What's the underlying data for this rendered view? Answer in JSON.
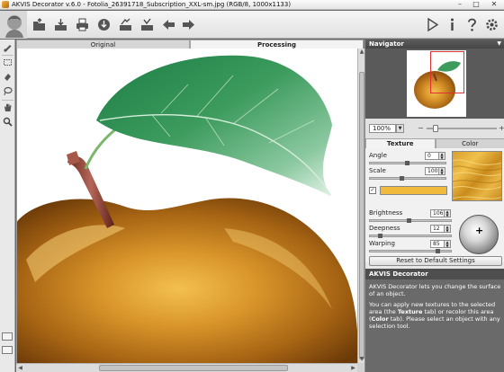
{
  "window": {
    "title": "AKVIS Decorator v.6.0 - Fotolia_26391718_Subscription_XXL-sm.jpg (RGB/8, 1000x1133)",
    "minimize": "–",
    "maximize": "□",
    "close": "✕"
  },
  "toolbar": {
    "left_icons": [
      "open-icon",
      "save-icon",
      "print-icon",
      "share-icon",
      "batch-icon",
      "presets-icon",
      "undo-icon",
      "redo-icon"
    ],
    "right_icons": [
      "run-icon",
      "info-icon",
      "help-icon",
      "settings-icon"
    ]
  },
  "image_tabs": {
    "original": "Original",
    "processing": "Processing"
  },
  "navigator": {
    "title": "Navigator",
    "zoom_value": "100%",
    "zoom_minus": "−",
    "zoom_plus": "+",
    "zoom_fraction": 0.1
  },
  "settings_tabs": {
    "texture": "Texture",
    "color": "Color"
  },
  "params": {
    "angle": {
      "label": "Angle",
      "value": "0"
    },
    "scale": {
      "label": "Scale",
      "value": "100"
    },
    "brightness": {
      "label": "Brightness",
      "value": "106"
    },
    "deepness": {
      "label": "Deepness",
      "value": "12"
    },
    "warping": {
      "label": "Warping",
      "value": "85"
    }
  },
  "color_checkbox_mark": "✓",
  "light_sphere_mark": "+",
  "reset_button": "Reset to Default Settings",
  "help": {
    "title": "AKVIS Decorator",
    "p1": "AKVIS Decorator lets you change the surface of an object.",
    "p2_a": "You can apply new textures to the selected area (the ",
    "p2_texture": "Texture",
    "p2_b": " tab) or recolor this area (",
    "p2_color": "Color",
    "p2_c": " tab). Please select an object with any selection tool."
  },
  "colors": {
    "accent_gold": "#f2ba3c",
    "panel_header": "#4e4e4e",
    "help_bg": "#6a6a6a"
  }
}
